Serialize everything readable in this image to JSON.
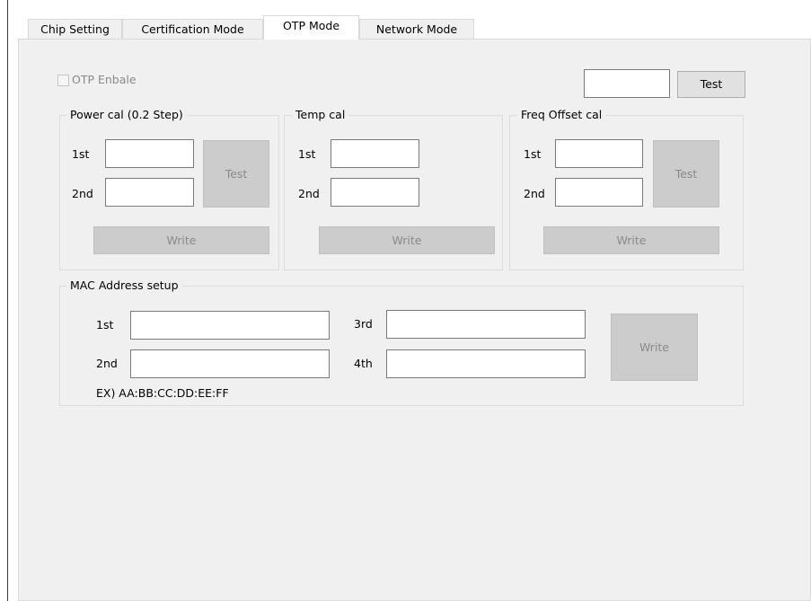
{
  "tabs": [
    {
      "label": "Chip Setting"
    },
    {
      "label": "Certification Mode"
    },
    {
      "label": "OTP Mode"
    },
    {
      "label": "Network Mode"
    }
  ],
  "otp_enable": {
    "label": "OTP Enbale",
    "checked": false
  },
  "top_test": {
    "value": "",
    "button_label": "Test"
  },
  "power_cal": {
    "title": "Power cal (0.2 Step)",
    "first_label": "1st",
    "first_value": "",
    "second_label": "2nd",
    "second_value": "",
    "test_label": "Test",
    "write_label": "Write"
  },
  "temp_cal": {
    "title": "Temp cal",
    "first_label": "1st",
    "first_value": "",
    "second_label": "2nd",
    "second_value": "",
    "write_label": "Write"
  },
  "freq_cal": {
    "title": "Freq Offset cal",
    "first_label": "1st",
    "first_value": "",
    "second_label": "2nd",
    "second_value": "",
    "test_label": "Test",
    "write_label": "Write"
  },
  "mac": {
    "title": "MAC Address setup",
    "first_label": "1st",
    "second_label": "2nd",
    "third_label": "3rd",
    "fourth_label": "4th",
    "first_value": "",
    "second_value": "",
    "third_value": "",
    "fourth_value": "",
    "example": "EX) AA:BB:CC:DD:EE:FF",
    "write_label": "Write"
  }
}
